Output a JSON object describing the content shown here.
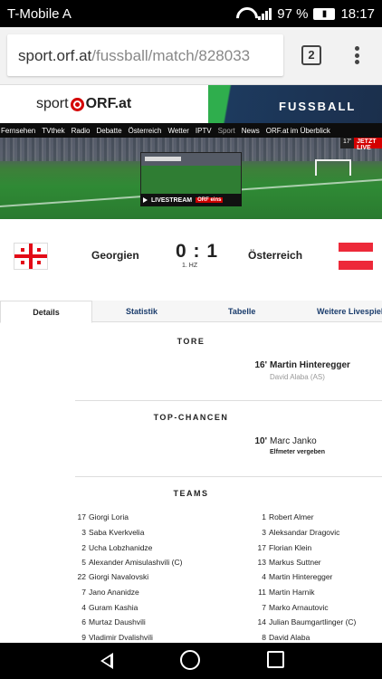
{
  "status": {
    "carrier": "T-Mobile A",
    "battery": "97 %",
    "time": "18:17"
  },
  "browser": {
    "url_host": "sport.orf.at",
    "url_path": "/fussball/match/828033",
    "tab_count": "2"
  },
  "site": {
    "logo_sport": "sport",
    "logo_orf": "ORF.at",
    "section": "FUSSBALL"
  },
  "nav": [
    "Fernsehen",
    "TVthek",
    "Radio",
    "Debatte",
    "Österreich",
    "Wetter",
    "IPTV",
    "Sport",
    "News",
    "ORF.at im Überblick"
  ],
  "banner": {
    "livestream": "LIVESTREAM",
    "channel": "ORF eins",
    "minute": "17'",
    "live": "JETZT LIVE"
  },
  "match": {
    "home": "Georgien",
    "away": "Österreich",
    "score": "0 : 1",
    "period": "1. HZ"
  },
  "tabs": [
    "Details",
    "Statistik",
    "Tabelle",
    "Weitere Livespiele"
  ],
  "tore": {
    "title": "TORE",
    "events": [
      {
        "minute": "16'",
        "player": "Martin Hinteregger",
        "assist": "David Alaba (AS)"
      }
    ]
  },
  "chancen": {
    "title": "TOP-CHANCEN",
    "events": [
      {
        "minute": "10'",
        "player": "Marc Janko",
        "note": "Elfmeter vergeben"
      }
    ]
  },
  "teams": {
    "title": "TEAMS",
    "home": [
      {
        "num": "17",
        "name": "Giorgi Loria"
      },
      {
        "num": "3",
        "name": "Saba Kverkvelia"
      },
      {
        "num": "2",
        "name": "Ucha Lobzhanidze"
      },
      {
        "num": "5",
        "name": "Alexander Amisulashvili (C)"
      },
      {
        "num": "22",
        "name": "Giorgi Navalovski"
      },
      {
        "num": "7",
        "name": "Jano Ananidze"
      },
      {
        "num": "4",
        "name": "Guram Kashia"
      },
      {
        "num": "6",
        "name": "Murtaz Daushvili"
      },
      {
        "num": "9",
        "name": "Vladimir Dvalishvili"
      }
    ],
    "away": [
      {
        "num": "1",
        "name": "Robert Almer"
      },
      {
        "num": "3",
        "name": "Aleksandar Dragovic"
      },
      {
        "num": "17",
        "name": "Florian Klein"
      },
      {
        "num": "13",
        "name": "Markus Suttner"
      },
      {
        "num": "4",
        "name": "Martin Hinteregger"
      },
      {
        "num": "11",
        "name": "Martin Harnik"
      },
      {
        "num": "7",
        "name": "Marko Arnautovic"
      },
      {
        "num": "14",
        "name": "Julian Baumgartlinger (C)"
      },
      {
        "num": "8",
        "name": "David Alaba"
      }
    ]
  },
  "colors": {
    "accent": "#d40000",
    "link": "#1a3c6c",
    "band": "#1b2f4c"
  }
}
